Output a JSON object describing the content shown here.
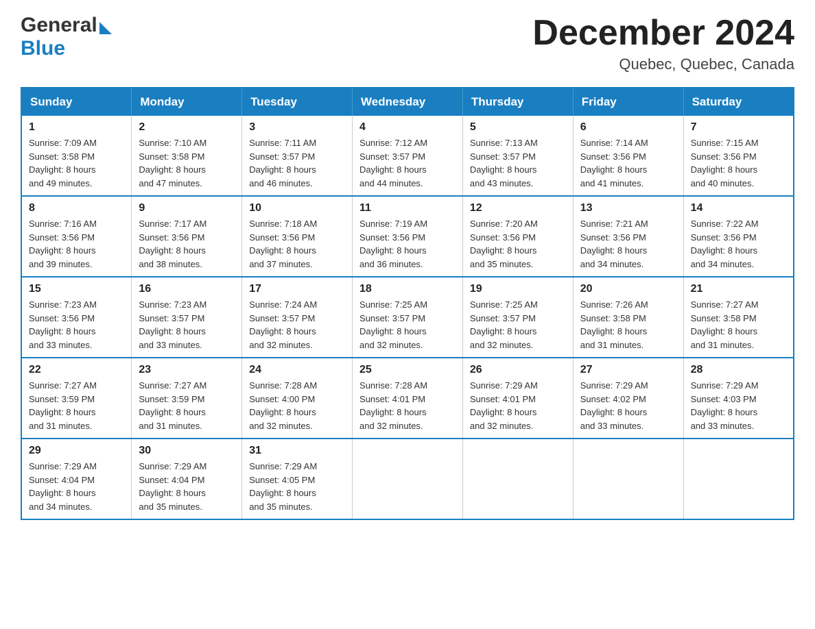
{
  "header": {
    "logo_general": "General",
    "logo_blue": "Blue",
    "month_title": "December 2024",
    "location": "Quebec, Quebec, Canada"
  },
  "days_of_week": [
    "Sunday",
    "Monday",
    "Tuesday",
    "Wednesday",
    "Thursday",
    "Friday",
    "Saturday"
  ],
  "weeks": [
    [
      {
        "day": "1",
        "sunrise": "7:09 AM",
        "sunset": "3:58 PM",
        "daylight": "8 hours and 49 minutes."
      },
      {
        "day": "2",
        "sunrise": "7:10 AM",
        "sunset": "3:58 PM",
        "daylight": "8 hours and 47 minutes."
      },
      {
        "day": "3",
        "sunrise": "7:11 AM",
        "sunset": "3:57 PM",
        "daylight": "8 hours and 46 minutes."
      },
      {
        "day": "4",
        "sunrise": "7:12 AM",
        "sunset": "3:57 PM",
        "daylight": "8 hours and 44 minutes."
      },
      {
        "day": "5",
        "sunrise": "7:13 AM",
        "sunset": "3:57 PM",
        "daylight": "8 hours and 43 minutes."
      },
      {
        "day": "6",
        "sunrise": "7:14 AM",
        "sunset": "3:56 PM",
        "daylight": "8 hours and 41 minutes."
      },
      {
        "day": "7",
        "sunrise": "7:15 AM",
        "sunset": "3:56 PM",
        "daylight": "8 hours and 40 minutes."
      }
    ],
    [
      {
        "day": "8",
        "sunrise": "7:16 AM",
        "sunset": "3:56 PM",
        "daylight": "8 hours and 39 minutes."
      },
      {
        "day": "9",
        "sunrise": "7:17 AM",
        "sunset": "3:56 PM",
        "daylight": "8 hours and 38 minutes."
      },
      {
        "day": "10",
        "sunrise": "7:18 AM",
        "sunset": "3:56 PM",
        "daylight": "8 hours and 37 minutes."
      },
      {
        "day": "11",
        "sunrise": "7:19 AM",
        "sunset": "3:56 PM",
        "daylight": "8 hours and 36 minutes."
      },
      {
        "day": "12",
        "sunrise": "7:20 AM",
        "sunset": "3:56 PM",
        "daylight": "8 hours and 35 minutes."
      },
      {
        "day": "13",
        "sunrise": "7:21 AM",
        "sunset": "3:56 PM",
        "daylight": "8 hours and 34 minutes."
      },
      {
        "day": "14",
        "sunrise": "7:22 AM",
        "sunset": "3:56 PM",
        "daylight": "8 hours and 34 minutes."
      }
    ],
    [
      {
        "day": "15",
        "sunrise": "7:23 AM",
        "sunset": "3:56 PM",
        "daylight": "8 hours and 33 minutes."
      },
      {
        "day": "16",
        "sunrise": "7:23 AM",
        "sunset": "3:57 PM",
        "daylight": "8 hours and 33 minutes."
      },
      {
        "day": "17",
        "sunrise": "7:24 AM",
        "sunset": "3:57 PM",
        "daylight": "8 hours and 32 minutes."
      },
      {
        "day": "18",
        "sunrise": "7:25 AM",
        "sunset": "3:57 PM",
        "daylight": "8 hours and 32 minutes."
      },
      {
        "day": "19",
        "sunrise": "7:25 AM",
        "sunset": "3:57 PM",
        "daylight": "8 hours and 32 minutes."
      },
      {
        "day": "20",
        "sunrise": "7:26 AM",
        "sunset": "3:58 PM",
        "daylight": "8 hours and 31 minutes."
      },
      {
        "day": "21",
        "sunrise": "7:27 AM",
        "sunset": "3:58 PM",
        "daylight": "8 hours and 31 minutes."
      }
    ],
    [
      {
        "day": "22",
        "sunrise": "7:27 AM",
        "sunset": "3:59 PM",
        "daylight": "8 hours and 31 minutes."
      },
      {
        "day": "23",
        "sunrise": "7:27 AM",
        "sunset": "3:59 PM",
        "daylight": "8 hours and 31 minutes."
      },
      {
        "day": "24",
        "sunrise": "7:28 AM",
        "sunset": "4:00 PM",
        "daylight": "8 hours and 32 minutes."
      },
      {
        "day": "25",
        "sunrise": "7:28 AM",
        "sunset": "4:01 PM",
        "daylight": "8 hours and 32 minutes."
      },
      {
        "day": "26",
        "sunrise": "7:29 AM",
        "sunset": "4:01 PM",
        "daylight": "8 hours and 32 minutes."
      },
      {
        "day": "27",
        "sunrise": "7:29 AM",
        "sunset": "4:02 PM",
        "daylight": "8 hours and 33 minutes."
      },
      {
        "day": "28",
        "sunrise": "7:29 AM",
        "sunset": "4:03 PM",
        "daylight": "8 hours and 33 minutes."
      }
    ],
    [
      {
        "day": "29",
        "sunrise": "7:29 AM",
        "sunset": "4:04 PM",
        "daylight": "8 hours and 34 minutes."
      },
      {
        "day": "30",
        "sunrise": "7:29 AM",
        "sunset": "4:04 PM",
        "daylight": "8 hours and 35 minutes."
      },
      {
        "day": "31",
        "sunrise": "7:29 AM",
        "sunset": "4:05 PM",
        "daylight": "8 hours and 35 minutes."
      },
      null,
      null,
      null,
      null
    ]
  ],
  "labels": {
    "sunrise": "Sunrise:",
    "sunset": "Sunset:",
    "daylight": "Daylight:"
  }
}
